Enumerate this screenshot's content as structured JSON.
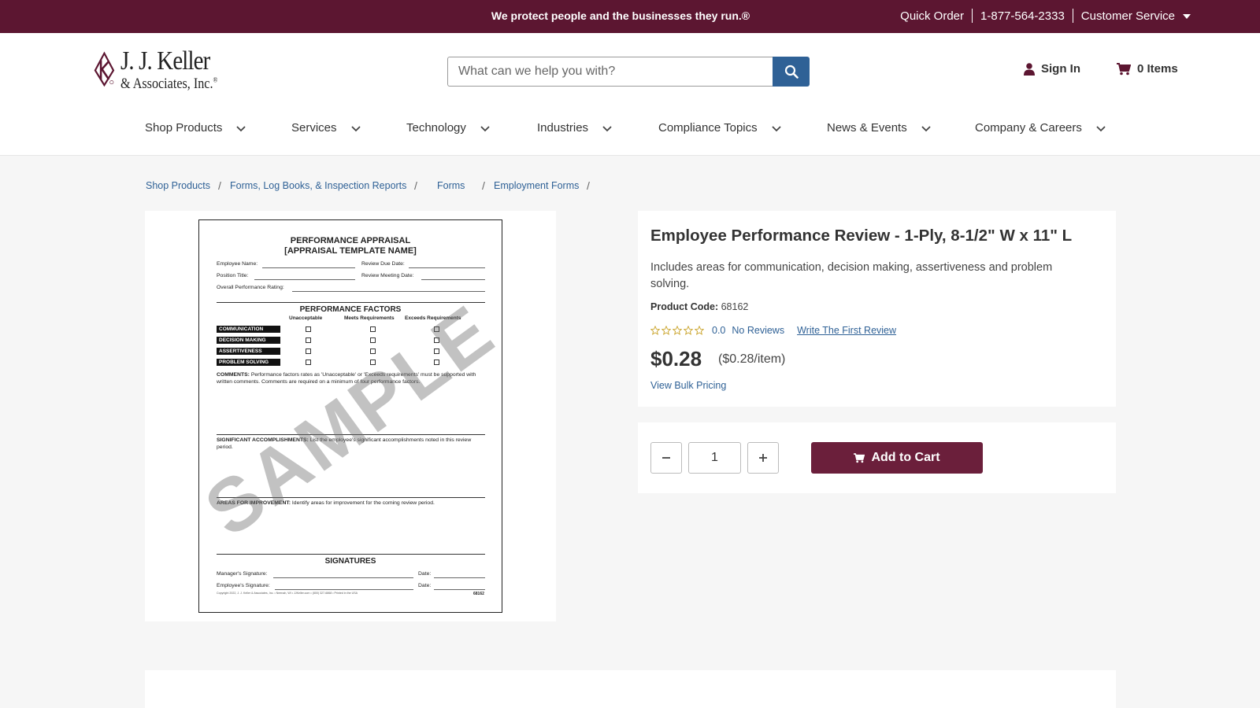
{
  "topbar": {
    "tagline": "We protect people and the businesses they run.®",
    "quick_order": "Quick Order",
    "phone": "1-877-564-2333",
    "customer_service": "Customer Service"
  },
  "brand": {
    "line1": "J. J. Keller",
    "line2": "& Associates, Inc.",
    "reg_mark": "®",
    "color": "#5c1631"
  },
  "search": {
    "placeholder": "What can we help you with?",
    "value": ""
  },
  "account": {
    "sign_in": "Sign In",
    "cart_label": "0 Items"
  },
  "nav": {
    "items": [
      {
        "label": "Shop Products"
      },
      {
        "label": "Services"
      },
      {
        "label": "Technology"
      },
      {
        "label": "Industries"
      },
      {
        "label": "Compliance Topics"
      },
      {
        "label": "News & Events"
      },
      {
        "label": "Company & Careers"
      }
    ]
  },
  "breadcrumb": {
    "items": [
      "Shop Products",
      "Forms, Log Books, & Inspection Reports",
      "Forms",
      "Employment Forms"
    ],
    "separator": "/"
  },
  "product": {
    "title": "Employee Performance Review - 1-Ply, 8-1/2\" W x 11\" L",
    "description": "Includes areas for communication, decision making, assertiveness and problem solving.",
    "code_label": "Product Code:",
    "code": "68162",
    "rating": {
      "score": "0.0",
      "reviews": "No Reviews",
      "write": "Write The First Review",
      "stars": 0,
      "max_stars": 5
    },
    "price": "$0.28",
    "unit_price": "($0.28/item)",
    "bulk_pricing": "View Bulk Pricing",
    "quantity": "1",
    "add_to_cart": "Add to Cart"
  },
  "form_image": {
    "title1": "PERFORMANCE APPRAISAL",
    "title2": "[APPRAISAL TEMPLATE NAME]",
    "employee_name": "Employee Name:",
    "review_due": "Review Due Date:",
    "position_title": "Position Title:",
    "review_meeting": "Review Meeting Date:",
    "overall": "Overall Performance Rating:",
    "factors_heading": "PERFORMANCE FACTORS",
    "columns": [
      "Unacceptable",
      "Meets Requirements",
      "Exceeds Requirements"
    ],
    "factors": [
      "COMMUNICATION",
      "DECISION MAKING",
      "ASSERTIVENESS",
      "PROBLEM SOLVING"
    ],
    "comments_label": "COMMENTS:",
    "comments_text": "Performance factors rates as 'Unacceptable' or 'Exceeds requirements' must be supported with written comments. Comments are required on a minimum of four performance factors.",
    "accomplishments_label": "SIGNIFICANT ACCOMPLISHMENTS:",
    "accomplishments_text": "List the employee's significant accomplishments noted in this review period.",
    "improvement_label": "AREAS FOR IMPROVEMENT:",
    "improvement_text": "Identify areas for improvement for the coming review period.",
    "signatures_heading": "SIGNATURES",
    "manager_sig": "Manager's Signature:",
    "employee_sig": "Employee's Signature:",
    "date_label": "Date:",
    "footer": "Copyright 2022, J. J. Keller & Associates, Inc. • Neenah, WI • JJKeller.com • (800) 327-6868 • Printed in the USA",
    "form_number": "68162",
    "watermark": "SAMPLE"
  }
}
